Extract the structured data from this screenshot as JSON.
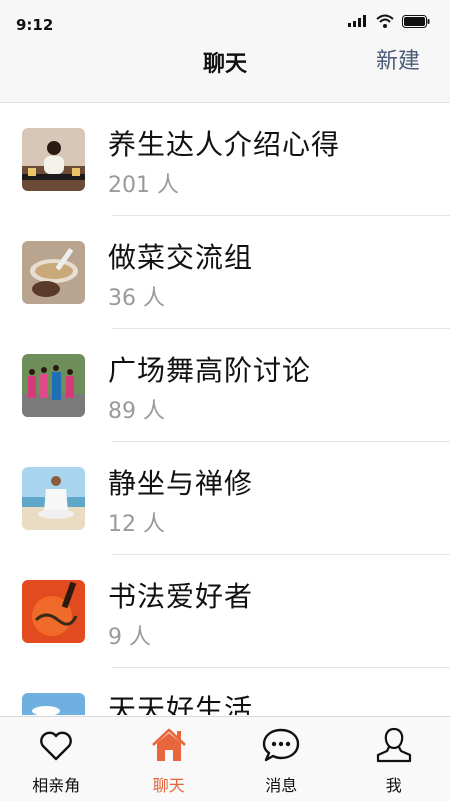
{
  "status_bar": {
    "time": "9:12"
  },
  "nav": {
    "title": "聊天",
    "action": "新建"
  },
  "groups": [
    {
      "name": "养生达人介绍心得",
      "count": "201 人",
      "thumb": "yoga-meditation-thumbnail"
    },
    {
      "name": "做菜交流组",
      "count": "36 人",
      "thumb": "soup-dish-thumbnail"
    },
    {
      "name": "广场舞高阶讨论",
      "count": "89 人",
      "thumb": "square-dance-thumbnail"
    },
    {
      "name": "静坐与禅修",
      "count": "12 人",
      "thumb": "beach-meditation-thumbnail"
    },
    {
      "name": "书法爱好者",
      "count": "9 人",
      "thumb": "calligraphy-thumbnail"
    },
    {
      "name": "天天好生活",
      "count": "",
      "thumb": "sky-thumbnail"
    }
  ],
  "tabs": [
    {
      "label": "相亲角",
      "icon": "heart-icon",
      "active": false
    },
    {
      "label": "聊天",
      "icon": "home-icon",
      "active": true
    },
    {
      "label": "消息",
      "icon": "chat-bubble-icon",
      "active": false
    },
    {
      "label": "我",
      "icon": "person-icon",
      "active": false
    }
  ],
  "colors": {
    "accent": "#e8663c",
    "nav_action": "#4a5a78",
    "count_text": "#9a9a9a"
  }
}
